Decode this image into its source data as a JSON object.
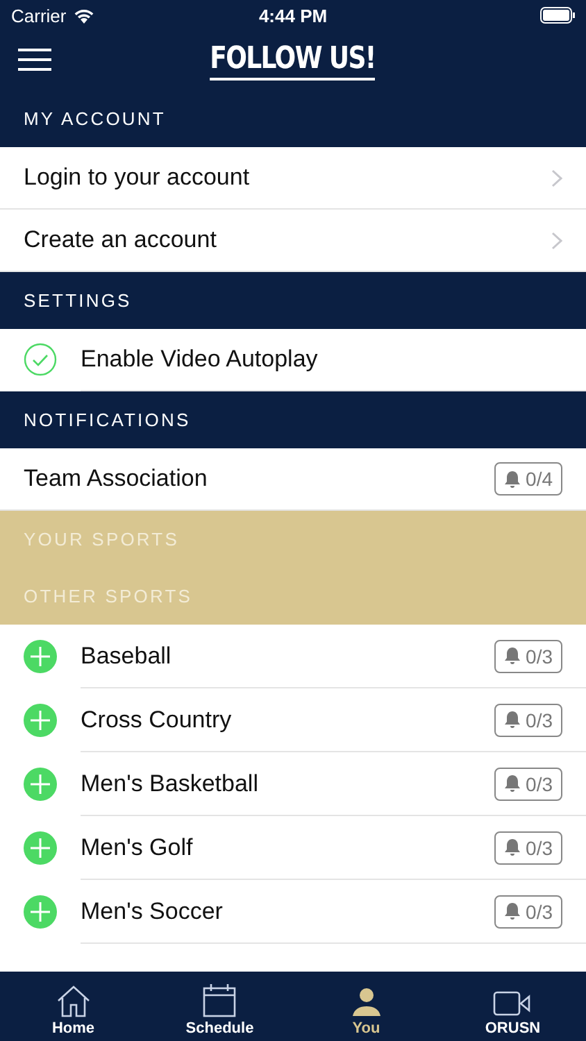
{
  "status_bar": {
    "carrier": "Carrier",
    "time": "4:44 PM"
  },
  "nav": {
    "title": "FOLLOW US!"
  },
  "sections": [
    {
      "title": "MY ACCOUNT",
      "color": "#0b1f42",
      "rows": [
        {
          "kind": "link",
          "label": "Login to your account"
        },
        {
          "kind": "link",
          "label": "Create an account"
        }
      ]
    },
    {
      "title": "SETTINGS",
      "color": "#0b1f42",
      "rows": [
        {
          "kind": "toggle",
          "label": "Enable Video Autoplay",
          "checked": true
        }
      ]
    },
    {
      "title": "NOTIFICATIONS",
      "color": "#0b1f42",
      "rows": [
        {
          "kind": "notify",
          "label": "Team Association",
          "count": "0/4"
        }
      ]
    },
    {
      "title": "YOUR SPORTS",
      "color": "#d8c690"
    },
    {
      "title": "OTHER SPORTS",
      "color": "#d8c690",
      "rows": [
        {
          "kind": "sport",
          "label": "Baseball",
          "count": "0/3"
        },
        {
          "kind": "sport",
          "label": "Cross Country",
          "count": "0/3"
        },
        {
          "kind": "sport",
          "label": "Men's Basketball",
          "count": "0/3"
        },
        {
          "kind": "sport",
          "label": "Men's Golf",
          "count": "0/3"
        },
        {
          "kind": "sport",
          "label": "Men's Soccer",
          "count": "0/3"
        }
      ]
    }
  ],
  "tab_bar": [
    {
      "kind": "home",
      "label": "Home",
      "selected": false
    },
    {
      "kind": "calendar",
      "label": "Schedule",
      "selected": false
    },
    {
      "kind": "person",
      "label": "You",
      "selected": true
    },
    {
      "kind": "video",
      "label": "ORUSN",
      "selected": false
    }
  ]
}
